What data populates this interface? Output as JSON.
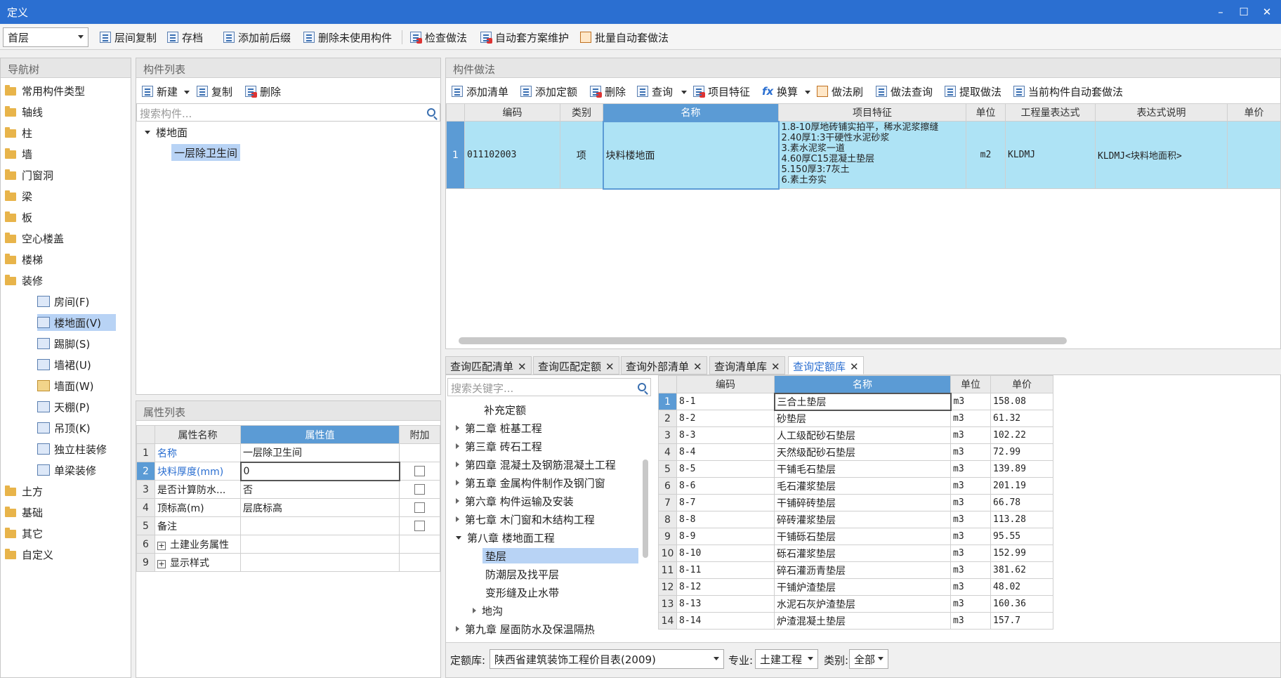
{
  "window": {
    "title": "定义"
  },
  "toolbar": {
    "floor": "首层",
    "items": [
      "层间复制",
      "存档",
      "添加前后缀",
      "删除未使用构件",
      "检查做法",
      "自动套方案维护",
      "批量自动套做法"
    ]
  },
  "nav": {
    "header": "导航树",
    "items": [
      "常用构件类型",
      "轴线",
      "柱",
      "墙",
      "门窗洞",
      "梁",
      "板",
      "空心楼盖",
      "楼梯",
      "装修"
    ],
    "sub_items": [
      "房间(F)",
      "楼地面(V)",
      "踢脚(S)",
      "墙裙(U)",
      "墙面(W)",
      "天棚(P)",
      "吊顶(K)",
      "独立柱装修",
      "单梁装修"
    ],
    "items2": [
      "土方",
      "基础",
      "其它",
      "自定义"
    ]
  },
  "comp_list": {
    "header": "构件列表",
    "new": "新建",
    "copy": "复制",
    "delete": "删除",
    "search_placeholder": "搜索构件...",
    "root": "楼地面",
    "child": "一层除卫生间"
  },
  "props": {
    "header": "属性列表",
    "cols": [
      "属性名称",
      "属性值",
      "附加"
    ],
    "rows": [
      {
        "n": "1",
        "name": "名称",
        "value": "一层除卫生间"
      },
      {
        "n": "2",
        "name": "块料厚度(mm)",
        "value": "0"
      },
      {
        "n": "3",
        "name": "是否计算防水...",
        "value": "否"
      },
      {
        "n": "4",
        "name": "顶标高(m)",
        "value": "层底标高"
      },
      {
        "n": "5",
        "name": "备注",
        "value": ""
      },
      {
        "n": "6",
        "name": "土建业务属性",
        "value": ""
      },
      {
        "n": "9",
        "name": "显示样式",
        "value": ""
      }
    ]
  },
  "method": {
    "header": "构件做法",
    "toolbar": [
      "添加清单",
      "添加定额",
      "删除",
      "查询",
      "项目特征",
      "换算",
      "做法刷",
      "做法查询",
      "提取做法",
      "当前构件自动套做法"
    ],
    "cols": [
      "编码",
      "类别",
      "名称",
      "项目特征",
      "单位",
      "工程量表达式",
      "表达式说明",
      "单价"
    ],
    "row": {
      "n": "1",
      "code": "011102003",
      "type": "项",
      "name": "块料楼地面",
      "features": [
        "1.8-10厚地砖铺实拍平，稀水泥浆擦缝",
        "2.40厚1:3干硬性水泥砂浆",
        "3.素水泥浆一道",
        "4.60厚C15混凝土垫层",
        "5.150厚3:7灰土",
        "6.素土夯实"
      ],
      "unit": "m2",
      "expr": "KLDMJ",
      "expr_desc": "KLDMJ<块料地面积>"
    }
  },
  "tabs": [
    "查询匹配清单",
    "查询匹配定额",
    "查询外部清单",
    "查询清单库",
    "查询定额库"
  ],
  "query": {
    "search_placeholder": "搜索关键字...",
    "tree": [
      "补充定额",
      "第二章 桩基工程",
      "第三章 砖石工程",
      "第四章 混凝土及钢筋混凝土工程",
      "第五章 金属构件制作及钢门窗",
      "第六章 构件运输及安装",
      "第七章 木门窗和木结构工程",
      "第八章 楼地面工程",
      "垫层",
      "防潮层及找平层",
      "变形缝及止水带",
      "地沟",
      "第九章 屋面防水及保温隔热"
    ],
    "cols": [
      "编码",
      "名称",
      "单位",
      "单价"
    ],
    "rows": [
      [
        "1",
        "8-1",
        "三合土垫层",
        "m3",
        "158.08"
      ],
      [
        "2",
        "8-2",
        "砂垫层",
        "m3",
        "61.32"
      ],
      [
        "3",
        "8-3",
        "人工级配砂石垫层",
        "m3",
        "102.22"
      ],
      [
        "4",
        "8-4",
        "天然级配砂石垫层",
        "m3",
        "72.99"
      ],
      [
        "5",
        "8-5",
        "干铺毛石垫层",
        "m3",
        "139.89"
      ],
      [
        "6",
        "8-6",
        "毛石灌浆垫层",
        "m3",
        "201.19"
      ],
      [
        "7",
        "8-7",
        "干铺碎砖垫层",
        "m3",
        "66.78"
      ],
      [
        "8",
        "8-8",
        "碎砖灌浆垫层",
        "m3",
        "113.28"
      ],
      [
        "9",
        "8-9",
        "干铺砾石垫层",
        "m3",
        "95.55"
      ],
      [
        "10",
        "8-10",
        "砾石灌浆垫层",
        "m3",
        "152.99"
      ],
      [
        "11",
        "8-11",
        "碎石灌沥青垫层",
        "m3",
        "381.62"
      ],
      [
        "12",
        "8-12",
        "干铺炉渣垫层",
        "m3",
        "48.02"
      ],
      [
        "13",
        "8-13",
        "水泥石灰炉渣垫层",
        "m3",
        "160.36"
      ],
      [
        "14",
        "8-14",
        "炉渣混凝土垫层",
        "m3",
        "157.7"
      ]
    ],
    "bottom": {
      "lib_label": "定额库:",
      "lib_value": "陕西省建筑装饰工程价目表(2009)",
      "spec_label": "专业:",
      "spec_value": "土建工程",
      "cat_label": "类别:",
      "cat_value": "全部"
    }
  }
}
